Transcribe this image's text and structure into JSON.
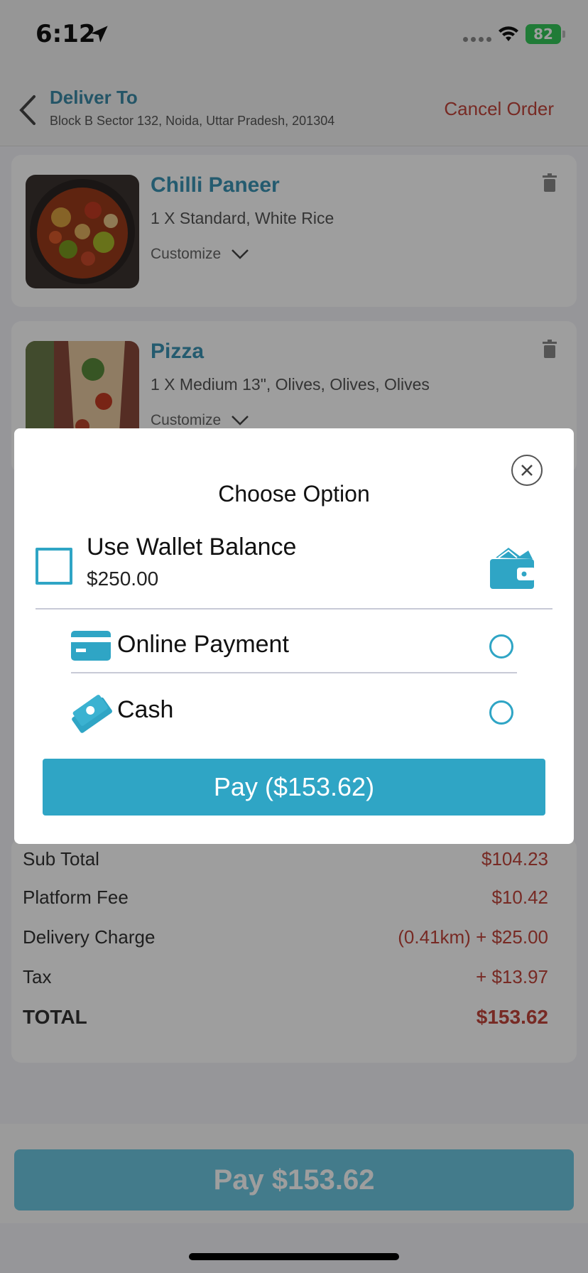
{
  "status_bar": {
    "time": "6:12",
    "battery": "82"
  },
  "header": {
    "deliver_to_label": "Deliver To",
    "address": "Block B Sector 132, Noida, Uttar Pradesh, 201304",
    "cancel_label": "Cancel Order"
  },
  "items": [
    {
      "name": "Chilli Paneer",
      "desc": "1 X Standard, White Rice",
      "customize_label": "Customize"
    },
    {
      "name": "Pizza",
      "desc": "1 X Medium 13\", Olives, Olives, Olives",
      "customize_label": "Customize"
    }
  ],
  "summary": {
    "sub_total_label": "Sub Total",
    "sub_total_value": "$104.23",
    "platform_fee_label": "Platform Fee",
    "platform_fee_value": "$10.42",
    "delivery_label": "Delivery Charge",
    "delivery_value": "(0.41km) + $25.00",
    "tax_label": "Tax",
    "tax_value": "+ $13.97",
    "total_label": "TOTAL",
    "total_value": "$153.62"
  },
  "pay_button_label": "Pay $153.62",
  "modal": {
    "title": "Choose Option",
    "wallet_label": "Use Wallet Balance",
    "wallet_amount": "$250.00",
    "wallet_checked": false,
    "options": [
      {
        "label": "Online Payment",
        "icon": "credit-card-icon",
        "selected": false
      },
      {
        "label": "Cash",
        "icon": "cash-icon",
        "selected": false
      }
    ],
    "pay_label": "Pay ($153.62)"
  },
  "colors": {
    "accent": "#2fa5c5",
    "price_red": "#c0443a",
    "title_teal": "#3a93b4"
  }
}
